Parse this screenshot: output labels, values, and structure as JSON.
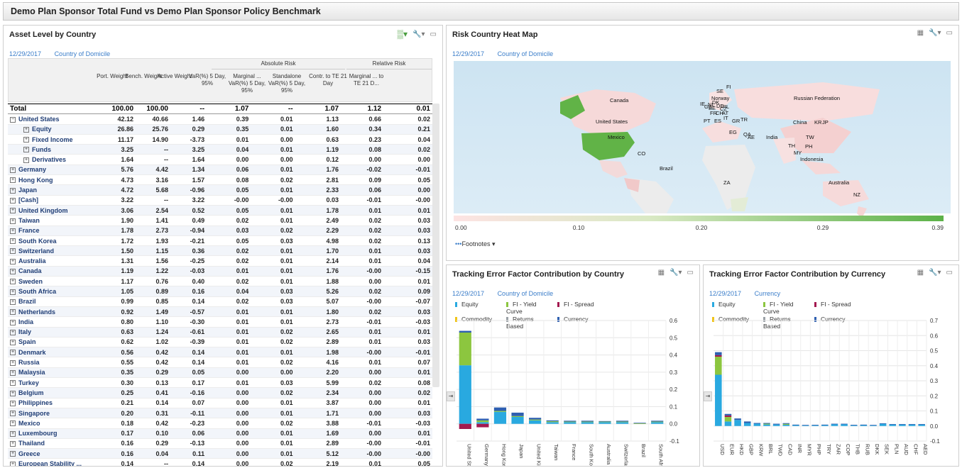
{
  "title": "Demo Plan Sponsor Total Fund vs Demo Plan Sponsor Policy Benchmark",
  "asset_panel": {
    "title": "Asset Level by Country",
    "date": "12/29/2017",
    "basis": "Country of Domicile",
    "group_abs": "Absolute Risk",
    "group_rel": "Relative Risk",
    "columns": [
      "Port. Weight",
      "Bench. Weight",
      "Active Weight",
      "VaR(%) 5 Day, 95%",
      "Marginal ... VaR(%) 5 Day, 95%",
      "Standalone VaR(%) 5 Day, 95%",
      "Contr. to TE 21 Day",
      "Marginal ... to TE 21 D..."
    ],
    "rows": [
      [
        "Total",
        "100.00",
        "100.00",
        "--",
        "1.07",
        "--",
        "1.07",
        "1.12",
        "0.01",
        0
      ],
      [
        "United States",
        "42.12",
        "40.66",
        "1.46",
        "0.39",
        "0.01",
        "1.13",
        "0.66",
        "0.02",
        1
      ],
      [
        "Equity",
        "26.86",
        "25.76",
        "0.29",
        "0.35",
        "0.01",
        "1.60",
        "0.34",
        "0.21",
        2
      ],
      [
        "Fixed Income",
        "11.17",
        "14.90",
        "-3.73",
        "0.01",
        "0.00",
        "0.63",
        "0.23",
        "0.04",
        2
      ],
      [
        "Funds",
        "3.25",
        "--",
        "3.25",
        "0.04",
        "0.01",
        "1.19",
        "0.08",
        "0.02",
        2
      ],
      [
        "Derivatives",
        "1.64",
        "--",
        "1.64",
        "0.00",
        "0.00",
        "0.12",
        "0.00",
        "0.00",
        2
      ],
      [
        "Germany",
        "5.76",
        "4.42",
        "1.34",
        "0.06",
        "0.01",
        "1.76",
        "-0.02",
        "-0.01",
        1
      ],
      [
        "Hong Kong",
        "4.73",
        "3.16",
        "1.57",
        "0.08",
        "0.02",
        "2.81",
        "0.09",
        "0.05",
        1
      ],
      [
        "Japan",
        "4.72",
        "5.68",
        "-0.96",
        "0.05",
        "0.01",
        "2.33",
        "0.06",
        "0.00",
        1
      ],
      [
        "[Cash]",
        "3.22",
        "--",
        "3.22",
        "-0.00",
        "-0.00",
        "0.03",
        "-0.01",
        "-0.00",
        1
      ],
      [
        "United Kingdom",
        "3.06",
        "2.54",
        "0.52",
        "0.05",
        "0.01",
        "1.78",
        "0.01",
        "0.01",
        1
      ],
      [
        "Taiwan",
        "1.90",
        "1.41",
        "0.49",
        "0.02",
        "0.01",
        "2.49",
        "0.02",
        "0.03",
        1
      ],
      [
        "France",
        "1.78",
        "2.73",
        "-0.94",
        "0.03",
        "0.02",
        "2.29",
        "0.02",
        "0.03",
        1
      ],
      [
        "South Korea",
        "1.72",
        "1.93",
        "-0.21",
        "0.05",
        "0.03",
        "4.98",
        "0.02",
        "0.13",
        1
      ],
      [
        "Switzerland",
        "1.50",
        "1.15",
        "0.36",
        "0.02",
        "0.01",
        "1.70",
        "0.01",
        "0.03",
        1
      ],
      [
        "Australia",
        "1.31",
        "1.56",
        "-0.25",
        "0.02",
        "0.01",
        "2.14",
        "0.01",
        "0.04",
        1
      ],
      [
        "Canada",
        "1.19",
        "1.22",
        "-0.03",
        "0.01",
        "0.01",
        "1.76",
        "-0.00",
        "-0.15",
        1
      ],
      [
        "Sweden",
        "1.17",
        "0.76",
        "0.40",
        "0.02",
        "0.01",
        "1.88",
        "0.00",
        "0.01",
        1
      ],
      [
        "South Africa",
        "1.05",
        "0.89",
        "0.16",
        "0.04",
        "0.03",
        "5.26",
        "0.02",
        "0.09",
        1
      ],
      [
        "Brazil",
        "0.99",
        "0.85",
        "0.14",
        "0.02",
        "0.03",
        "5.07",
        "-0.00",
        "-0.07",
        1
      ],
      [
        "Netherlands",
        "0.92",
        "1.49",
        "-0.57",
        "0.01",
        "0.01",
        "1.80",
        "0.02",
        "0.03",
        1
      ],
      [
        "India",
        "0.80",
        "1.10",
        "-0.30",
        "0.01",
        "0.01",
        "2.73",
        "-0.01",
        "-0.03",
        1
      ],
      [
        "Italy",
        "0.63",
        "1.24",
        "-0.61",
        "0.01",
        "0.02",
        "2.65",
        "0.01",
        "0.01",
        1
      ],
      [
        "Spain",
        "0.62",
        "1.02",
        "-0.39",
        "0.01",
        "0.02",
        "2.89",
        "0.01",
        "0.03",
        1
      ],
      [
        "Denmark",
        "0.56",
        "0.42",
        "0.14",
        "0.01",
        "0.01",
        "1.98",
        "-0.00",
        "-0.01",
        1
      ],
      [
        "Russia",
        "0.55",
        "0.42",
        "0.14",
        "0.01",
        "0.02",
        "4.16",
        "0.01",
        "0.07",
        1
      ],
      [
        "Malaysia",
        "0.35",
        "0.29",
        "0.05",
        "0.00",
        "0.00",
        "2.20",
        "0.00",
        "0.01",
        1
      ],
      [
        "Turkey",
        "0.30",
        "0.13",
        "0.17",
        "0.01",
        "0.03",
        "5.99",
        "0.02",
        "0.08",
        1
      ],
      [
        "Belgium",
        "0.25",
        "0.41",
        "-0.16",
        "0.00",
        "0.02",
        "2.34",
        "0.00",
        "0.02",
        1
      ],
      [
        "Philippines",
        "0.21",
        "0.14",
        "0.07",
        "0.00",
        "0.01",
        "3.87",
        "0.00",
        "0.01",
        1
      ],
      [
        "Singapore",
        "0.20",
        "0.31",
        "-0.11",
        "0.00",
        "0.01",
        "1.71",
        "0.00",
        "0.03",
        1
      ],
      [
        "Mexico",
        "0.18",
        "0.42",
        "-0.23",
        "0.00",
        "0.02",
        "3.88",
        "-0.01",
        "-0.03",
        1
      ],
      [
        "Luxembourg",
        "0.17",
        "0.10",
        "0.06",
        "0.00",
        "0.01",
        "1.69",
        "0.00",
        "0.01",
        1
      ],
      [
        "Thailand",
        "0.16",
        "0.29",
        "-0.13",
        "0.00",
        "0.01",
        "2.89",
        "-0.00",
        "-0.01",
        1
      ],
      [
        "Greece",
        "0.16",
        "0.04",
        "0.11",
        "0.00",
        "0.01",
        "5.12",
        "-0.00",
        "-0.00",
        1
      ],
      [
        "European Stability ...",
        "0.14",
        "--",
        "0.14",
        "0.00",
        "0.02",
        "2.19",
        "0.01",
        "0.05",
        1
      ]
    ]
  },
  "heatmap": {
    "title": "Risk Country Heat Map",
    "date": "12/29/2017",
    "basis": "Country of Domicile",
    "scale_ticks": [
      "0.00",
      "0.10",
      "0.20",
      "0.29",
      "0.39"
    ],
    "footnotes": "Footnotes",
    "labels": [
      [
        "Canada",
        858,
        143
      ],
      [
        "United States",
        838,
        173
      ],
      [
        "Mexico",
        855,
        195
      ],
      [
        "Russian Federation",
        1117,
        140
      ],
      [
        "China",
        1116,
        174
      ],
      [
        "KR",
        1146,
        174
      ],
      [
        "JP",
        1157,
        174
      ],
      [
        "India",
        1078,
        195
      ],
      [
        "TW",
        1134,
        195
      ],
      [
        "TH",
        1109,
        207
      ],
      [
        "PH",
        1133,
        208
      ],
      [
        "MY",
        1117,
        217
      ],
      [
        "Indonesia",
        1126,
        226
      ],
      [
        "Brazil",
        928,
        239
      ],
      [
        "ZA",
        1018,
        259
      ],
      [
        "Australia",
        1166,
        259
      ],
      [
        "NZ",
        1201,
        276
      ],
      [
        "CO",
        897,
        218
      ],
      [
        "EG",
        1026,
        188
      ],
      [
        "AE",
        1052,
        195
      ],
      [
        "QA",
        1046,
        191
      ],
      [
        "Norway",
        1001,
        140
      ],
      [
        "SE",
        1008,
        130
      ],
      [
        "FI",
        1022,
        124
      ],
      [
        "PT",
        990,
        172
      ],
      [
        "ES",
        1005,
        172
      ],
      [
        "IT",
        1018,
        168
      ],
      [
        "GR",
        1030,
        172
      ],
      [
        "TR",
        1042,
        170
      ],
      [
        "IE",
        985,
        148
      ],
      [
        "NL",
        996,
        149
      ],
      [
        "DE",
        1008,
        151
      ],
      [
        "PL",
        1017,
        152
      ],
      [
        "FR",
        999,
        161
      ],
      [
        "CH",
        1007,
        161
      ],
      [
        "AT",
        1016,
        161
      ],
      [
        "DK",
        1002,
        146
      ],
      [
        "GB",
        991,
        152
      ],
      [
        "BE",
        997,
        154
      ],
      [
        "CZ",
        1013,
        155
      ]
    ]
  },
  "te_country": {
    "title": "Tracking Error Factor Contribution by Country",
    "date": "12/29/2017",
    "basis": "Country of Domicile",
    "legend": [
      "Equity",
      "FI - Yield Curve",
      "FI - Spread",
      "Commodity",
      "Returns Based",
      "Currency"
    ],
    "colors": {
      "Equity": "#29a9e0",
      "FI - Yield Curve": "#8cc63f",
      "FI - Spread": "#a3194f",
      "Commodity": "#f0c419",
      "Returns Based": "#9aa0a6",
      "Currency": "#2e5fb0"
    }
  },
  "te_currency": {
    "title": "Tracking Error Factor Contribution by Currency",
    "date": "12/29/2017",
    "basis": "Currency",
    "legend": [
      "Equity",
      "FI - Yield Curve",
      "FI - Spread",
      "Commodity",
      "Returns Based",
      "Currency"
    ]
  },
  "chart_data": [
    {
      "type": "bar",
      "title": "Tracking Error Factor Contribution by Country",
      "ylim": [
        -0.1,
        0.6
      ],
      "yticks": [
        "0.6",
        "0.5",
        "0.4",
        "0.3",
        "0.2",
        "0.1",
        "0.0",
        "-0.1"
      ],
      "categories": [
        "United States",
        "Germany",
        "Hong Kong",
        "Japan",
        "United Kingdom",
        "Taiwan",
        "France",
        "South Korea",
        "Australia",
        "Switzerland",
        "Brazil",
        "South Africa"
      ],
      "series": [
        {
          "name": "Equity",
          "values": [
            0.34,
            0.01,
            0.07,
            0.04,
            0.02,
            0.01,
            0.01,
            0.01,
            0.01,
            0.01,
            0.0,
            0.01
          ]
        },
        {
          "name": "FI - Yield Curve",
          "values": [
            0.19,
            0.01,
            0.005,
            0.005,
            0.005,
            0.005,
            0.003,
            0.003,
            0.003,
            0.003,
            0.003,
            0.003
          ]
        },
        {
          "name": "FI - Spread",
          "values": [
            -0.03,
            -0.02,
            0.0,
            0.0,
            0.0,
            0.0,
            0.0,
            0.0,
            0.0,
            0.0,
            0.0,
            0.0
          ]
        },
        {
          "name": "Currency",
          "values": [
            0.01,
            0.01,
            0.02,
            0.02,
            0.01,
            0.005,
            0.005,
            0.005,
            0.003,
            0.005,
            0.003,
            0.005
          ]
        }
      ]
    },
    {
      "type": "bar",
      "title": "Tracking Error Factor Contribution by Currency",
      "ylim": [
        -0.1,
        0.7
      ],
      "yticks": [
        "0.7",
        "0.6",
        "0.5",
        "0.4",
        "0.3",
        "0.2",
        "0.1",
        "0.0",
        "-0.1"
      ],
      "categories": [
        "USD",
        "EUR",
        "HKD",
        "GBP",
        "KRW",
        "BRL",
        "TWD",
        "CAD",
        "INR",
        "MYR",
        "PHP",
        "TRY",
        "ZAR",
        "COP",
        "THB",
        "RUB",
        "DKK",
        "SEK",
        "PLN",
        "AUD",
        "CHF",
        "AED"
      ],
      "series": [
        {
          "name": "Equity",
          "values": [
            0.34,
            0.03,
            0.04,
            0.02,
            0.015,
            0.01,
            0.01,
            0.008,
            0.006,
            0.004,
            0.005,
            0.006,
            0.012,
            0.012,
            0.005,
            0.006,
            0.004,
            0.015,
            0.01,
            0.01,
            0.01,
            0.01
          ]
        },
        {
          "name": "FI - Yield Curve",
          "values": [
            0.12,
            0.03,
            0.0,
            0.0,
            0.0,
            0.005,
            0.0,
            0.006,
            0.0,
            0.0,
            0.0,
            0.0,
            0.0,
            0.0,
            0.0,
            0.0,
            0.0,
            0.0,
            0.0,
            0.0,
            0.0,
            0.0
          ]
        },
        {
          "name": "FI - Spread",
          "values": [
            0.01,
            0.01,
            0.0,
            0.0,
            0.0,
            0.0,
            0.0,
            0.0,
            0.0,
            0.0,
            0.0,
            0.0,
            0.0,
            0.0,
            0.0,
            0.0,
            0.0,
            0.0,
            0.0,
            0.0,
            0.0,
            0.0
          ]
        },
        {
          "name": "Currency",
          "values": [
            0.02,
            0.01,
            0.01,
            0.01,
            0.005,
            0.005,
            0.005,
            0.005,
            0.003,
            0.003,
            0.003,
            0.003,
            0.003,
            0.003,
            0.003,
            0.003,
            0.003,
            0.003,
            0.003,
            0.003,
            0.003,
            0.003
          ]
        }
      ]
    }
  ]
}
